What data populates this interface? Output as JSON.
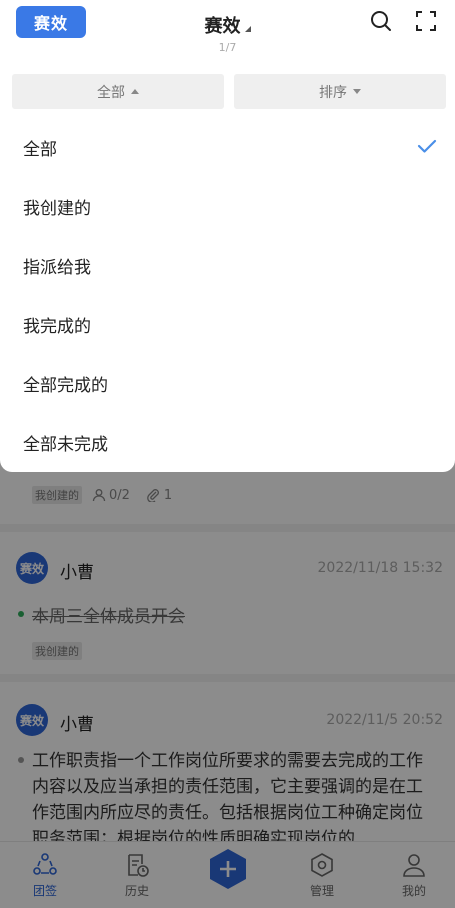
{
  "header": {
    "logo_text": "赛效",
    "title": "赛效",
    "page_indicator": "1/7",
    "search_icon": "search-icon",
    "fullscreen_icon": "fullscreen-icon"
  },
  "filters": {
    "left_label": "全部",
    "right_label": "排序"
  },
  "dropdown": {
    "options": [
      "全部",
      "我创建的",
      "指派给我",
      "我完成的",
      "全部完成的",
      "全部未完成"
    ],
    "selected_index": 0,
    "check_color": "#4a8fe8"
  },
  "feed": {
    "card1": {
      "tag": "我创建的",
      "assignees": "0/2",
      "attachments": "1"
    },
    "card2": {
      "avatar": "赛效",
      "user": "小曹",
      "time": "2022/11/18 15:32",
      "task": "本周三全体成员开会",
      "tag": "我创建的",
      "dot_color": "#2fae5b"
    },
    "card3": {
      "avatar": "赛效",
      "user": "小曹",
      "time": "2022/11/5 20:52",
      "task": "工作职责指一个工作岗位所要求的需要去完成的工作内容以及应当承担的责任范围，它主要强调的是在工作范围内所应尽的责任。包括根据岗位工种确定岗位职务范围；根据岗位的性质明确实现岗位的",
      "dot_color": "#999999"
    }
  },
  "tabbar": {
    "tabs": [
      "团签",
      "历史",
      "管理",
      "我的"
    ],
    "active": "团签",
    "accent": "#2f66d8"
  }
}
